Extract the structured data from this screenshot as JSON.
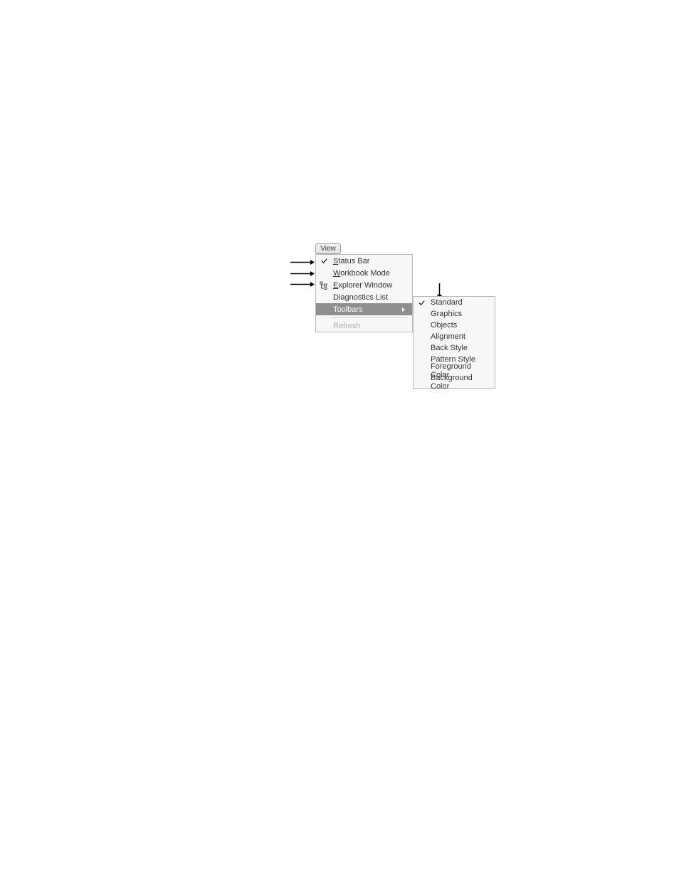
{
  "view_button": {
    "label": "View"
  },
  "menu": {
    "items": [
      {
        "label": "Status Bar",
        "underline": "S",
        "checked": true,
        "icon": null
      },
      {
        "label": "Workbook Mode",
        "underline": "W",
        "checked": false,
        "icon": null
      },
      {
        "label": "Explorer Window",
        "underline": "E",
        "checked": false,
        "icon": "tree"
      },
      {
        "label": "Diagnostics List",
        "underline": null,
        "checked": false,
        "icon": null
      },
      {
        "label": "Toolbars",
        "underline": null,
        "checked": false,
        "icon": null,
        "selected": true,
        "submenu": true
      }
    ],
    "disabled_item": {
      "label": "Refresh"
    }
  },
  "submenu": {
    "items": [
      {
        "label": "Standard",
        "checked": true
      },
      {
        "label": "Graphics",
        "checked": false
      },
      {
        "label": "Objects",
        "checked": false
      },
      {
        "label": "Alignment",
        "checked": false
      },
      {
        "label": "Back Style",
        "checked": false
      },
      {
        "label": "Pattern Style",
        "checked": false
      },
      {
        "label": "Foreground Color",
        "checked": false
      },
      {
        "label": "Background Color",
        "checked": false
      }
    ]
  },
  "annotations": {
    "left_arrows": 3,
    "top_arrow": 1
  }
}
